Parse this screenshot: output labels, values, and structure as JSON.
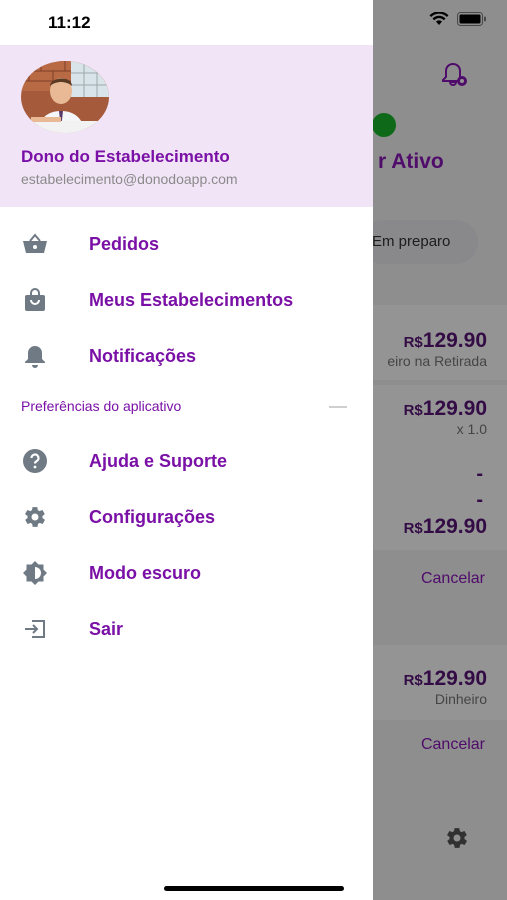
{
  "status_bar": {
    "time": "11:12"
  },
  "drawer": {
    "header": {
      "name": "Dono do Estabelecimento",
      "email": "estabelecimento@donodoapp.com"
    },
    "menu": [
      {
        "label": "Pedidos",
        "icon": "basket-icon"
      },
      {
        "label": "Meus Estabelecimentos",
        "icon": "store-bag-icon"
      },
      {
        "label": "Notificações",
        "icon": "bell-icon"
      }
    ],
    "preferences_section": "Preferências do aplicativo",
    "preferences": [
      {
        "label": "Ajuda e Suporte",
        "icon": "help-circle-icon"
      },
      {
        "label": "Configurações",
        "icon": "gear-icon"
      },
      {
        "label": "Modo escuro",
        "icon": "brightness-icon"
      },
      {
        "label": "Sair",
        "icon": "logout-icon"
      }
    ]
  },
  "background_app": {
    "status_label": "r Ativo",
    "chip_label": "Em preparo",
    "orders": [
      {
        "price": "129.90",
        "currency": "R$",
        "note": "eiro na Retirada"
      },
      {
        "price": "129.90",
        "currency": "R$",
        "note": "x 1.0"
      },
      {
        "price": "129.90",
        "currency": "R$",
        "note": ""
      },
      {
        "price": "129.90",
        "currency": "R$",
        "note": "Dinheiro"
      }
    ],
    "dashes": [
      "-",
      "-"
    ],
    "cancel_label": "Cancelar",
    "cancel_label_2": "Cancelar"
  },
  "colors": {
    "brand": "#7a10a6",
    "header_bg": "#f1e4f6",
    "active_dot": "#19b52b"
  }
}
